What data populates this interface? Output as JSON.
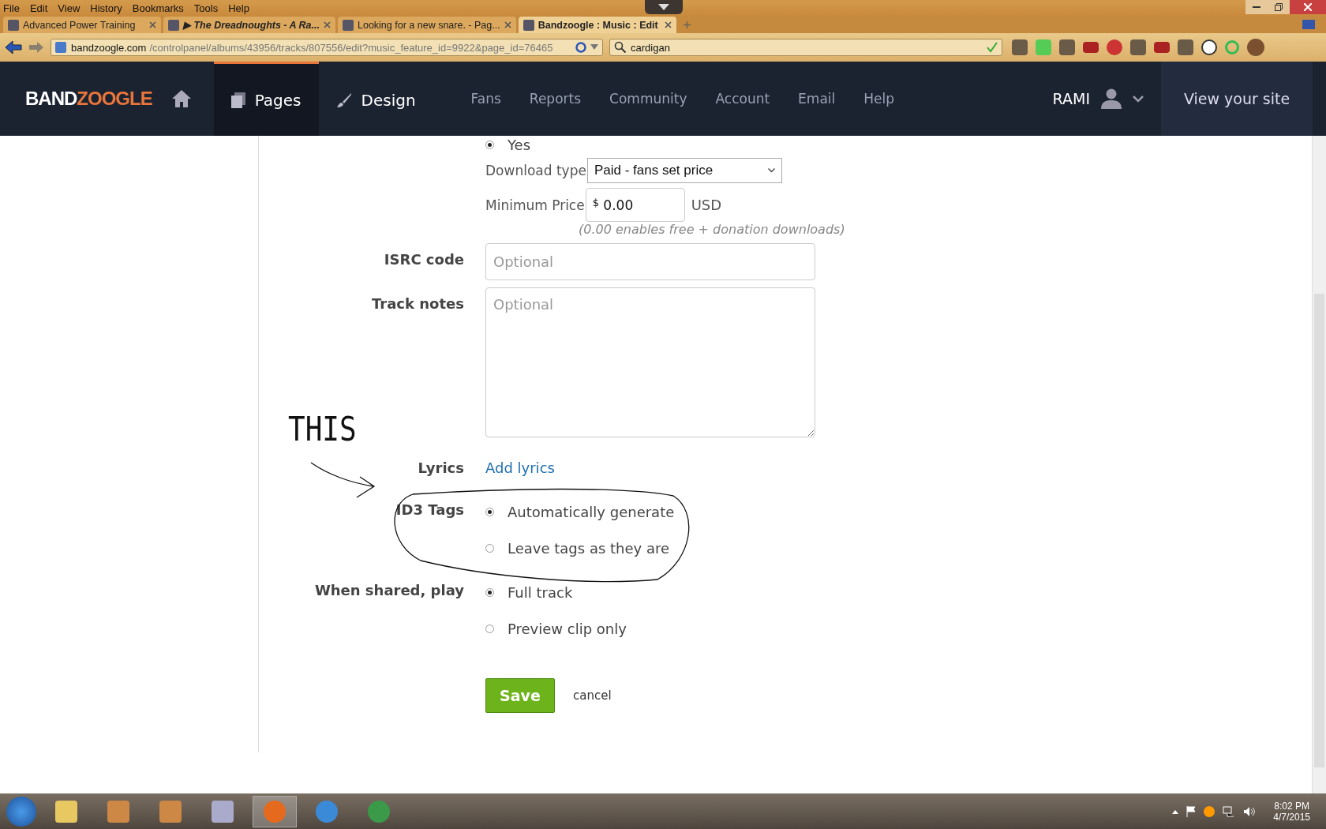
{
  "browser": {
    "menu": [
      "File",
      "Edit",
      "View",
      "History",
      "Bookmarks",
      "Tools",
      "Help"
    ],
    "tabs": [
      {
        "title": "Advanced Power Training",
        "selected": false,
        "italic": false
      },
      {
        "title": "▶ The Dreadnoughts - A Ra...",
        "selected": false,
        "italic": true
      },
      {
        "title": "Looking for a new snare. - Pag...",
        "selected": false,
        "italic": false
      },
      {
        "title": "Bandzoogle : Music : Edit",
        "selected": true,
        "italic": false
      }
    ],
    "url": {
      "host": "bandzoogle.com",
      "path": "/controlpanel/albums/43956/tracks/807556/edit?music_feature_id=9922&page_id=76465"
    },
    "search": {
      "value": "cardigan"
    }
  },
  "nav": {
    "logo": {
      "first": "BAND",
      "second": "ZOOGLE"
    },
    "items": [
      {
        "label": "Pages",
        "kind": "primary",
        "selected": true
      },
      {
        "label": "Design",
        "kind": "primary",
        "selected": false
      },
      {
        "label": "Fans",
        "kind": "secondary",
        "selected": false
      },
      {
        "label": "Reports",
        "kind": "secondary",
        "selected": false
      },
      {
        "label": "Community",
        "kind": "secondary",
        "selected": false
      },
      {
        "label": "Account",
        "kind": "secondary",
        "selected": false
      },
      {
        "label": "Email",
        "kind": "secondary",
        "selected": false
      },
      {
        "label": "Help",
        "kind": "secondary",
        "selected": false
      }
    ],
    "user": "RAMI",
    "view_site": "View your site"
  },
  "form": {
    "download": {
      "option": {
        "label": "Yes",
        "selected": true
      },
      "type_label": "Download type",
      "type_value": "Paid - fans set price",
      "price_label": "Minimum Price",
      "currency_symbol": "$",
      "price_value": "0.00",
      "currency": "USD",
      "hint": "(0.00 enables free + donation downloads)"
    },
    "fields": [
      {
        "kind": "text",
        "label": "ISRC code",
        "placeholder": "Optional"
      },
      {
        "kind": "textarea",
        "label": "Track notes",
        "placeholder": "Optional"
      },
      {
        "kind": "link",
        "label": "Lyrics",
        "link": "Add lyrics"
      },
      {
        "kind": "radios",
        "label": "ID3 Tags",
        "options": [
          {
            "label": "Automatically generate",
            "selected": true
          },
          {
            "label": "Leave tags as they are",
            "selected": false
          }
        ]
      },
      {
        "kind": "radios",
        "label": "When shared, play",
        "options": [
          {
            "label": "Full track",
            "selected": true
          },
          {
            "label": "Preview clip only",
            "selected": false
          }
        ]
      }
    ],
    "save": "Save",
    "cancel": "cancel"
  },
  "annotation": {
    "text": "THIS"
  },
  "taskbar": {
    "time": "8:02 PM",
    "date": "4/7/2015"
  }
}
